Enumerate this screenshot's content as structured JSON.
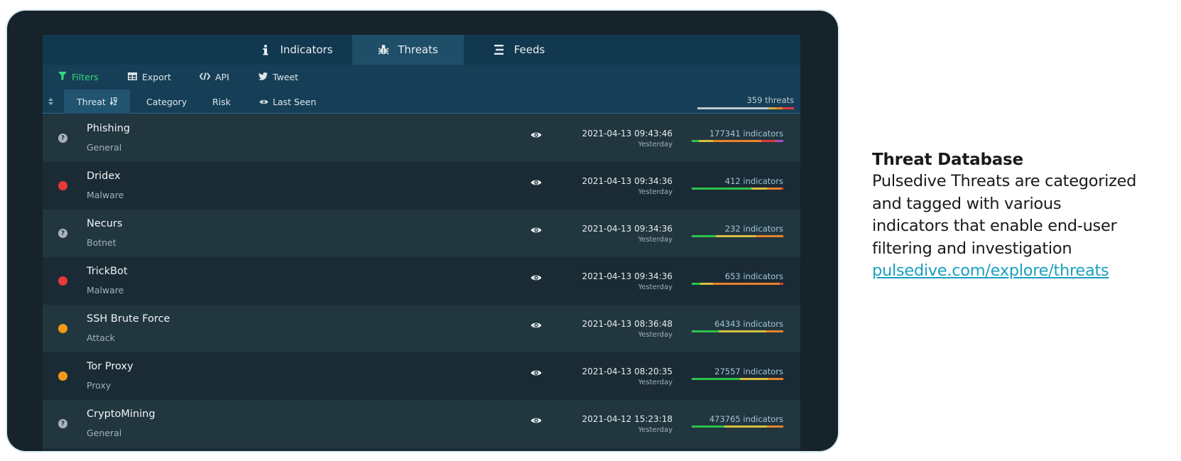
{
  "tabs": [
    {
      "label": "Indicators",
      "icon": "info-icon"
    },
    {
      "label": "Threats",
      "icon": "bug-icon",
      "active": true
    },
    {
      "label": "Feeds",
      "icon": "feeds-icon"
    }
  ],
  "toolbar": {
    "filters": "Filters",
    "export": "Export",
    "api": "API",
    "tweet": "Tweet"
  },
  "sortbar": {
    "threat": "Threat",
    "category": "Category",
    "risk": "Risk",
    "last_seen": "Last Seen",
    "count": "359 threats"
  },
  "threats": [
    {
      "name": "Phishing",
      "category": "General",
      "risk": "unknown",
      "date": "2021-04-13 09:43:46",
      "relative": "Yesterday",
      "indicators": "177341 indicators"
    },
    {
      "name": "Dridex",
      "category": "Malware",
      "risk": "red",
      "date": "2021-04-13 09:34:36",
      "relative": "Yesterday",
      "indicators": "412 indicators"
    },
    {
      "name": "Necurs",
      "category": "Botnet",
      "risk": "unknown",
      "date": "2021-04-13 09:34:36",
      "relative": "Yesterday",
      "indicators": "232 indicators"
    },
    {
      "name": "TrickBot",
      "category": "Malware",
      "risk": "red",
      "date": "2021-04-13 09:34:36",
      "relative": "Yesterday",
      "indicators": "653 indicators"
    },
    {
      "name": "SSH Brute Force",
      "category": "Attack",
      "risk": "orange",
      "date": "2021-04-13 08:36:48",
      "relative": "Yesterday",
      "indicators": "64343 indicators"
    },
    {
      "name": "Tor Proxy",
      "category": "Proxy",
      "risk": "orange",
      "date": "2021-04-13 08:20:35",
      "relative": "Yesterday",
      "indicators": "27557 indicators"
    },
    {
      "name": "CryptoMining",
      "category": "General",
      "risk": "unknown",
      "date": "2021-04-12 15:23:18",
      "relative": "Yesterday",
      "indicators": "473765 indicators"
    }
  ],
  "description": {
    "title": "Threat Database",
    "line1": "Pulsedive Threats are categorized",
    "line2": "and tagged with various",
    "line3": "indicators that enable end-user",
    "line4": "filtering and investigation",
    "link": "pulsedive.com/explore/threats"
  },
  "colors": {
    "accent_green": "#38d77a",
    "risk_red": "#e8393a",
    "risk_orange": "#f29a16",
    "link": "#1aa0c0"
  }
}
